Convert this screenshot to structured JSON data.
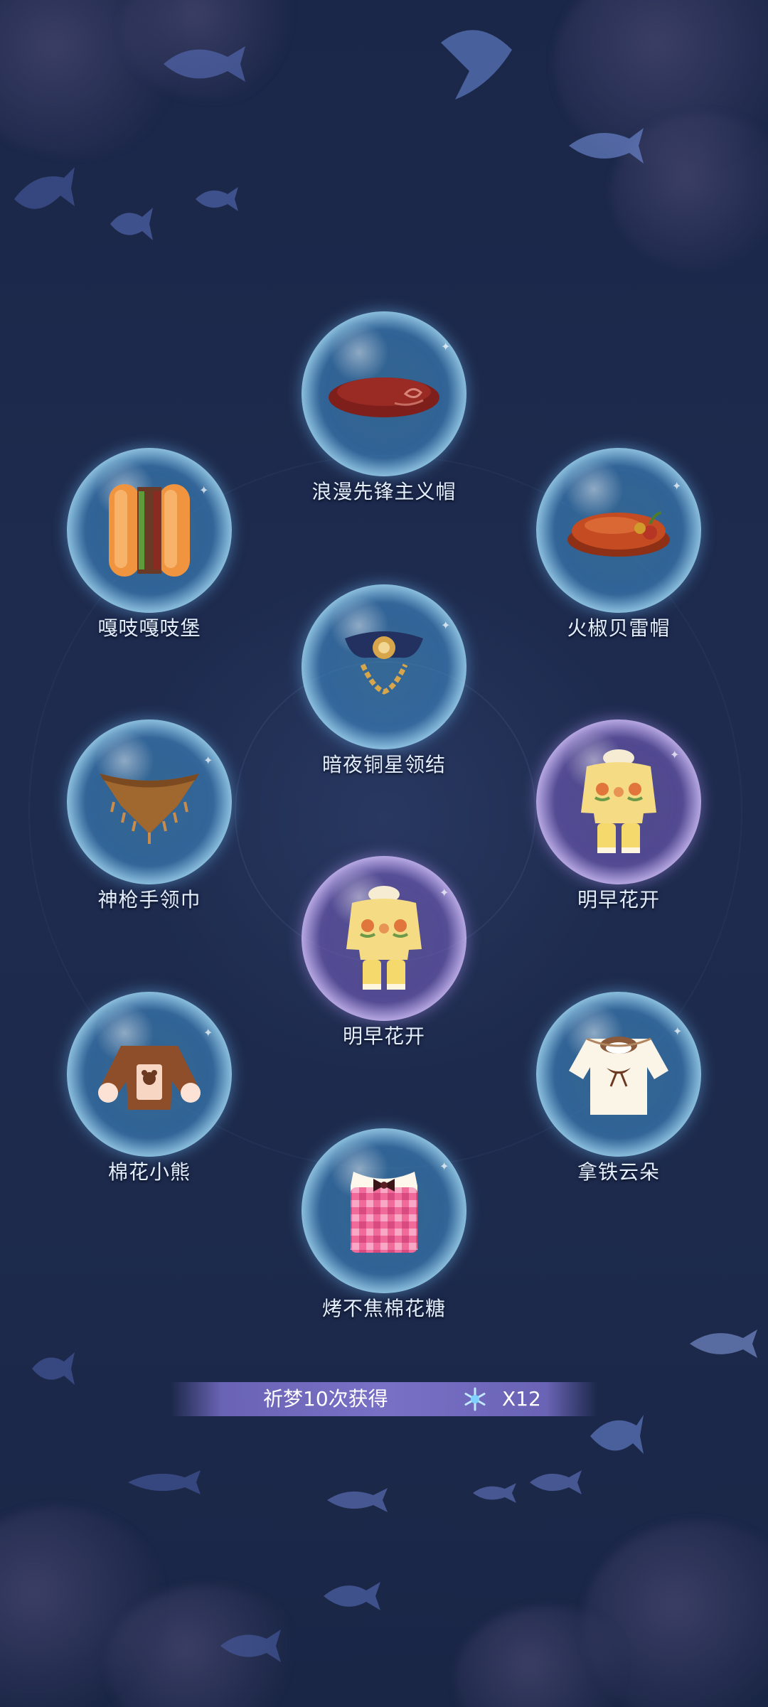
{
  "items": [
    {
      "name": "浪漫先锋主义帽",
      "bubble": "blue",
      "icon": "red-beret-hat-icon"
    },
    {
      "name": "嘎吱嘎吱堡",
      "bubble": "blue",
      "icon": "hotdog-burger-icon"
    },
    {
      "name": "火椒贝雷帽",
      "bubble": "blue",
      "icon": "chili-beret-icon"
    },
    {
      "name": "暗夜铜星领结",
      "bubble": "blue",
      "icon": "bow-tie-icon"
    },
    {
      "name": "神枪手领巾",
      "bubble": "blue",
      "icon": "scarf-icon"
    },
    {
      "name": "明早花开",
      "bubble": "purple",
      "icon": "flower-outfit-icon"
    },
    {
      "name": "明早花开",
      "bubble": "purple",
      "icon": "flower-outfit-icon"
    },
    {
      "name": "棉花小熊",
      "bubble": "blue",
      "icon": "bear-jacket-icon"
    },
    {
      "name": "拿铁云朵",
      "bubble": "blue",
      "icon": "latte-blouse-icon"
    },
    {
      "name": "烤不焦棉花糖",
      "bubble": "blue",
      "icon": "plaid-dress-icon"
    }
  ],
  "footer": {
    "text": "祈梦10次获得",
    "icon": "snowflake-currency-icon",
    "count": "X12"
  },
  "colors": {
    "background": "#1d2a4c",
    "bubble_blue": "#5aa8dc",
    "bubble_purple": "#8c78d0",
    "label": "#e4eefc",
    "footer_bar": "#7e72cc"
  }
}
